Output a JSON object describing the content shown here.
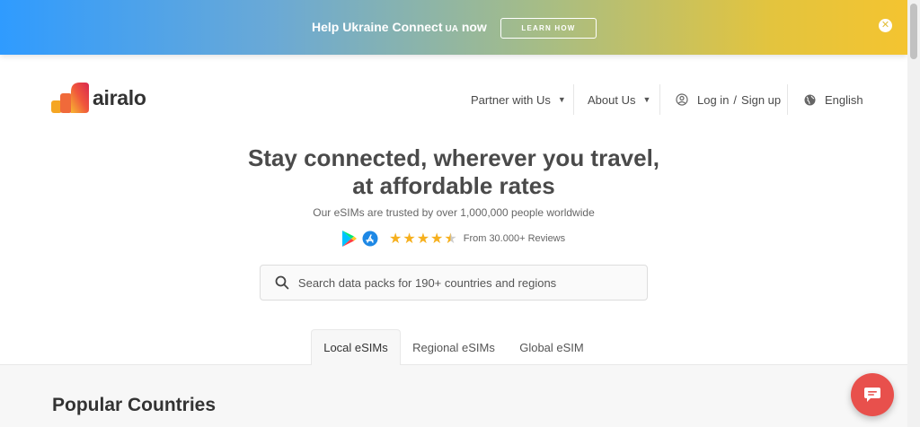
{
  "banner": {
    "text": "Help Ukraine Connect",
    "suffix": "UA",
    "tail": "now",
    "button_label": "LEARN HOW",
    "close_glyph": "✕"
  },
  "header": {
    "logo_text": "airalo",
    "nav": {
      "partner": "Partner with Us",
      "about": "About Us",
      "login": "Log in",
      "login_sep": "/",
      "signup": "Sign up",
      "language": "English"
    }
  },
  "hero": {
    "title_line1": "Stay connected, wherever you travel,",
    "title_line2": "at affordable rates",
    "subtitle": "Our eSIMs are trusted by over 1,000,000 people worldwide",
    "rating_value": 4.5,
    "reviews": "From 30.000+ Reviews"
  },
  "search": {
    "placeholder": "Search data packs for 190+ countries and regions"
  },
  "tabs": [
    {
      "label": "Local eSIMs",
      "active": true
    },
    {
      "label": "Regional eSIMs",
      "active": false
    },
    {
      "label": "Global eSIM",
      "active": false
    }
  ],
  "section": {
    "title": "Popular Countries"
  },
  "icons": {
    "play_store": "google-play-icon",
    "app_store": "app-store-icon",
    "chat": "chat-icon",
    "globe": "globe-icon",
    "user": "user-icon"
  },
  "colors": {
    "accent": "#e8504c",
    "star": "#f6b01e",
    "banner_start": "#2f9bff",
    "banner_end": "#f4c430"
  }
}
